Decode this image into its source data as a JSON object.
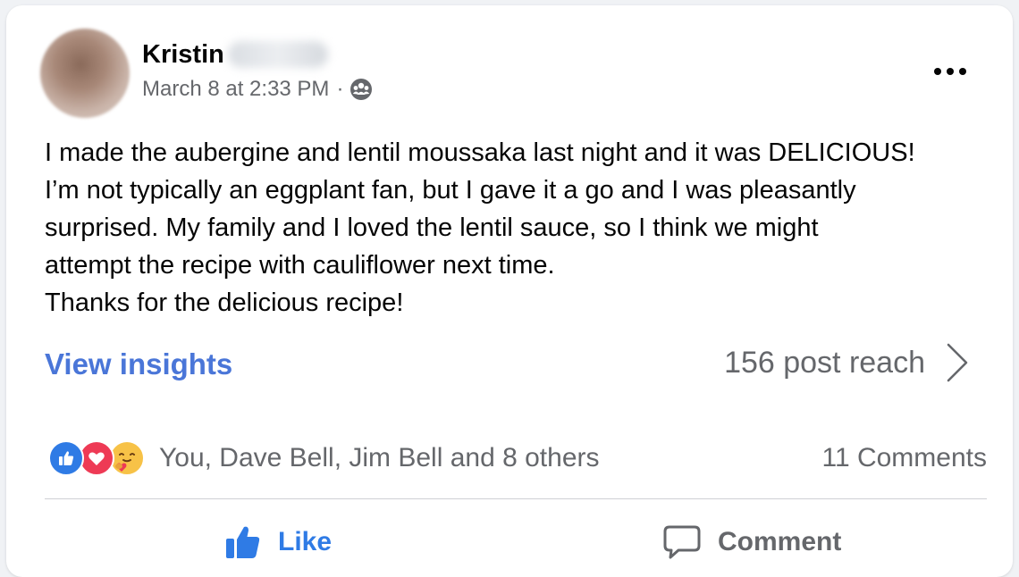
{
  "post": {
    "author_first_name": "Kristin",
    "timestamp": "March 8 at 2:33 PM",
    "separator": "·",
    "audience_icon": "friends-group-icon",
    "more_icon": "ellipsis-icon",
    "body": {
      "lines": [
        "I made the aubergine and lentil moussaka last night and it was DELICIOUS!",
        "I’m not typically an eggplant fan, but I gave it a go and I was pleasantly",
        "surprised. My family and I loved the lentil sauce, so I think we might",
        "attempt the recipe with cauliflower next time.",
        "Thanks for the delicious recipe!"
      ]
    }
  },
  "insights": {
    "link_label": "View insights",
    "reach_label": "156 post reach",
    "chevron_icon": "chevron-right-icon"
  },
  "engagement": {
    "reaction_icons": [
      "like-reaction-icon",
      "love-reaction-icon",
      "care-reaction-icon"
    ],
    "reactors_text": "You, Dave Bell, Jim Bell and 8 others",
    "comments_text": "11 Comments"
  },
  "actions": {
    "like_label": "Like",
    "comment_label": "Comment"
  },
  "colors": {
    "link_blue": "#4a76d8",
    "like_blue": "#2f7be5",
    "love_red": "#ee3a55",
    "care_yellow": "#f7c247",
    "secondary_text": "#65676b"
  }
}
